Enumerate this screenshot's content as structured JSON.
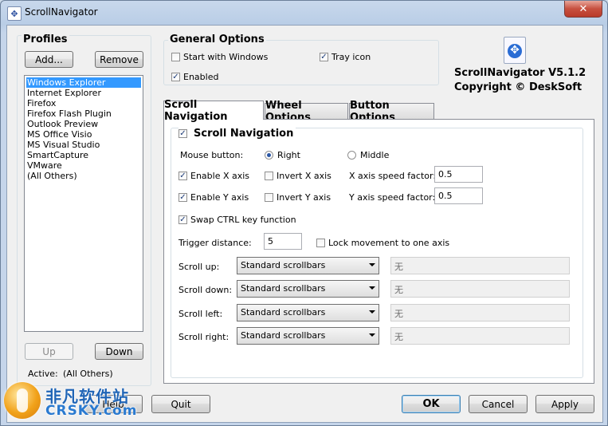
{
  "window": {
    "title": "ScrollNavigator",
    "close_glyph": "✕"
  },
  "profiles": {
    "title": "Profiles",
    "add_label": "Add...",
    "remove_label": "Remove",
    "items": [
      "Windows Explorer",
      "Internet Explorer",
      "Firefox",
      "Firefox Flash Plugin",
      "Outlook Preview",
      "MS Office Visio",
      "MS Visual Studio",
      "SmartCapture",
      "VMware",
      "(All Others)"
    ],
    "selected_index": 0,
    "up_label": "Up",
    "down_label": "Down",
    "active_label": "Active:",
    "active_value": "(All Others)"
  },
  "general": {
    "title": "General Options",
    "start_with_windows": {
      "label": "Start with Windows",
      "checked": false
    },
    "tray_icon": {
      "label": "Tray icon",
      "checked": true
    },
    "enabled": {
      "label": "Enabled",
      "checked": true
    }
  },
  "about": {
    "product": "ScrollNavigator V5.1.2",
    "copyright": "Copyright © DeskSoft"
  },
  "tabs": [
    "Scroll Navigation",
    "Wheel Options",
    "Button Options"
  ],
  "active_tab": 0,
  "scroll": {
    "section_label": "Scroll Navigation",
    "section_checked": true,
    "mouse_button_label": "Mouse button:",
    "right_label": "Right",
    "middle_label": "Middle",
    "selected_button": "Right",
    "enable_x": {
      "label": "Enable X axis",
      "checked": true
    },
    "invert_x": {
      "label": "Invert X axis",
      "checked": false
    },
    "x_speed_label": "X axis speed factor:",
    "x_speed_value": "0.5",
    "enable_y": {
      "label": "Enable Y axis",
      "checked": true
    },
    "invert_y": {
      "label": "Invert Y axis",
      "checked": false
    },
    "y_speed_label": "Y axis speed factor:",
    "y_speed_value": "0.5",
    "swap_ctrl": {
      "label": "Swap CTRL key function",
      "checked": true
    },
    "trigger_label": "Trigger distance:",
    "trigger_value": "5",
    "lock_movement": {
      "label": "Lock movement to one axis",
      "checked": false
    },
    "rows": [
      {
        "label": "Scroll up:",
        "select": "Standard scrollbars",
        "hotkey": "无"
      },
      {
        "label": "Scroll down:",
        "select": "Standard scrollbars",
        "hotkey": "无"
      },
      {
        "label": "Scroll left:",
        "select": "Standard scrollbars",
        "hotkey": "无"
      },
      {
        "label": "Scroll right:",
        "select": "Standard scrollbars",
        "hotkey": "无"
      }
    ]
  },
  "footer": {
    "help_label": "Help",
    "quit_label": "Quit",
    "ok_label": "OK",
    "cancel_label": "Cancel",
    "apply_label": "Apply"
  },
  "watermark": {
    "cn": "非凡软件站",
    "en": "CRSKY.com"
  },
  "colors": {
    "selection": "#3399ff",
    "title_bar": "#c8d8ec",
    "close_button": "#c7503f"
  },
  "icons": {
    "app": "scroll-navigator-icon",
    "logo": "scroll-navigator-logo-icon"
  }
}
